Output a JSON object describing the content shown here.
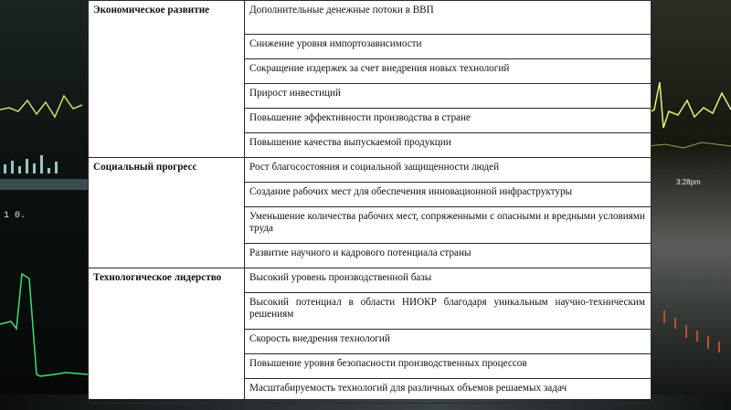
{
  "sections": [
    {
      "category": "Экономическое развитие",
      "items": [
        "Дополнительные денежные потоки в ВВП",
        "Снижение уровня импортозависимости",
        "Сокращение издержек за счет внедрения новых технологий",
        "Прирост инвестиций",
        "Повышение эффективности производства в стране",
        "Повышение качества выпускаемой продукции"
      ]
    },
    {
      "category": "Социальный прогресс",
      "items": [
        "Рост благосостояния и социальной защищенности людей",
        "Создание рабочих мест для обеспечения инновационной инфраструктуры",
        "Уменьшение количества рабочих мест, сопряженными с опасными и вредными условиями труда",
        "Развитие научного и кадрового потенциала страны"
      ]
    },
    {
      "category": "Технологическое лидерство",
      "items": [
        "Высокий уровень производственной базы",
        "Высокий потенциал в области НИОКР благодаря уникальным научно-техническим решениям",
        "Скорость внедрения технологий",
        "Повышение уровня безопасности производственных процессов",
        "Масштабируемость технологий для различных объемов решаемых задач"
      ]
    }
  ],
  "background": {
    "time_label": "3:28pm",
    "left_reading": "1 0.",
    "accent_color": "#cfe06a"
  }
}
